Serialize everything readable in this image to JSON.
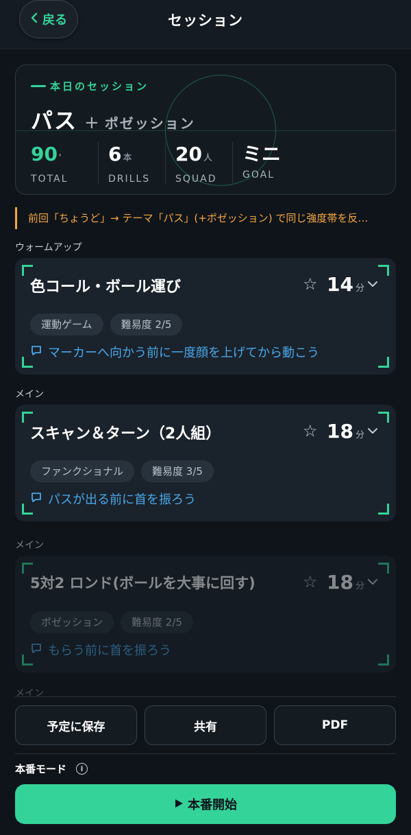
{
  "header": {
    "back_label": "戻る",
    "title": "セッション"
  },
  "summary": {
    "kicker": "本日のセッション",
    "title_main": "パス",
    "title_plus": "+",
    "title_sub": "ポゼッション",
    "stats": [
      {
        "value": "90",
        "unit": "'",
        "label": "TOTAL"
      },
      {
        "value": "6",
        "unit": "本",
        "label": "DRILLS"
      },
      {
        "value": "20",
        "unit": "人",
        "label": "SQUAD"
      },
      {
        "value": "ミニ",
        "unit": "",
        "label": "GOAL"
      }
    ]
  },
  "notice": "前回「ちょうど」→ テーマ「パス」(+ポゼッション) で同じ強度帯を反…",
  "sections": [
    {
      "label": "ウォームアップ",
      "drill": {
        "title": "色コール・ボール運び",
        "minutes": "14",
        "unit": "分",
        "tags": [
          "運動ゲーム",
          "難易度 2/5"
        ],
        "tip": "マーカーへ向かう前に一度顔を上げてから動こう"
      }
    },
    {
      "label": "メイン",
      "drill": {
        "title": "スキャン＆ターン（2人組）",
        "minutes": "18",
        "unit": "分",
        "tags": [
          "ファンクショナル",
          "難易度 3/5"
        ],
        "tip": "パスが出る前に首を振ろう"
      }
    },
    {
      "label": "メイン",
      "drill": {
        "title": "5対2 ロンド(ボールを大事に回す)",
        "minutes": "18",
        "unit": "分",
        "tags": [
          "ポゼッション",
          "難易度 2/5"
        ],
        "tip": "もらう前に首を振ろう"
      }
    },
    {
      "label": "メイン"
    }
  ],
  "actions": {
    "save": "予定に保存",
    "share": "共有",
    "pdf": "PDF"
  },
  "mode_label": "本番モード",
  "start_label": "本番開始",
  "colors": {
    "accent": "#34d399",
    "warning": "#f5a742",
    "tip": "#4aa7e8",
    "background": "#0f141a"
  }
}
